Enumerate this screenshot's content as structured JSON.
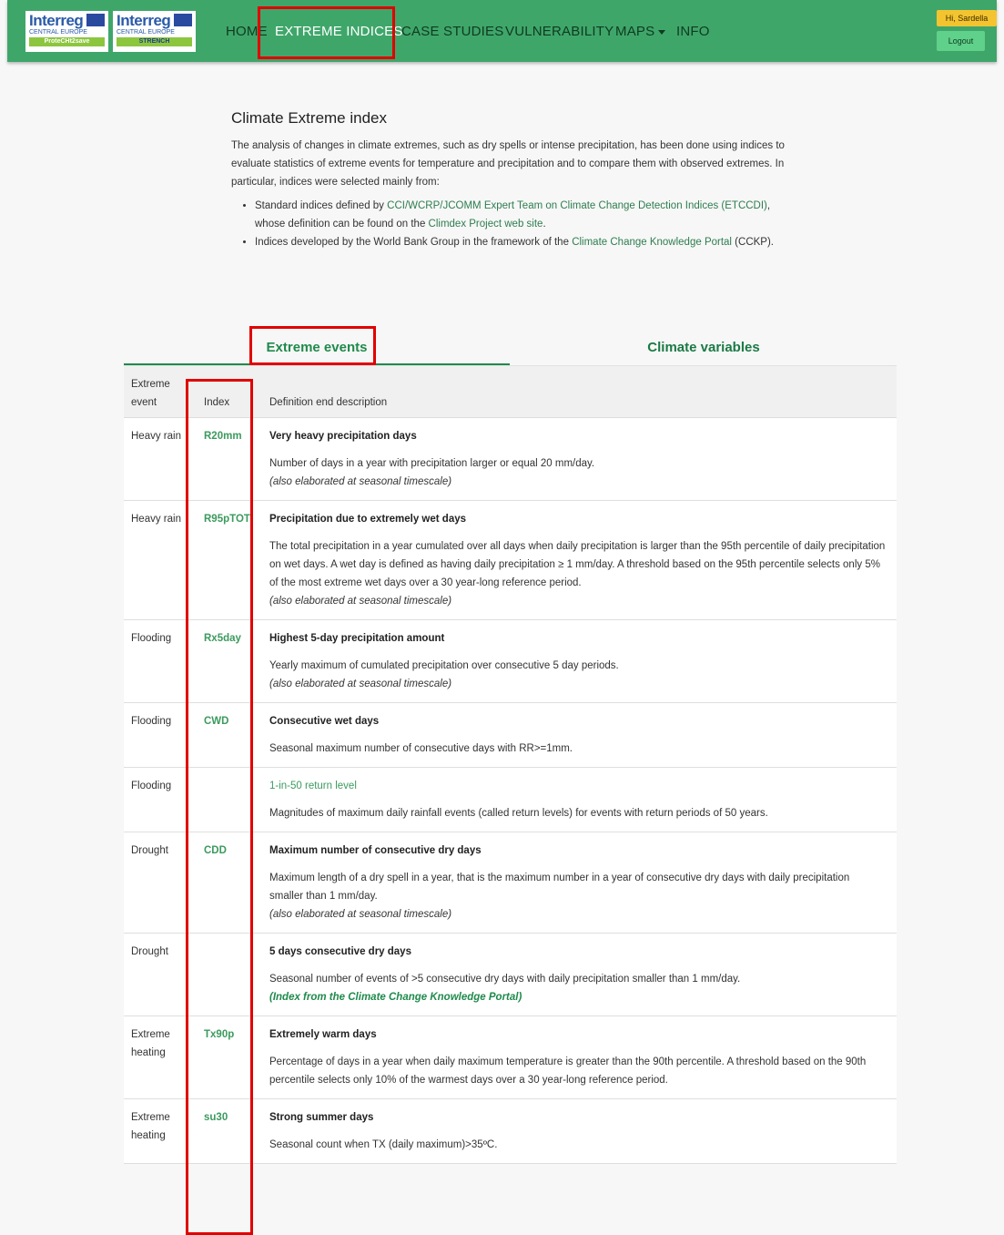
{
  "header": {
    "logos": [
      {
        "brand": "Interreg",
        "program": "CENTRAL EUROPE",
        "project": "ProteCHt2save"
      },
      {
        "brand": "Interreg",
        "program": "CENTRAL EUROPE",
        "project": "STRENCH"
      }
    ],
    "nav": [
      {
        "label": "HOME"
      },
      {
        "label": "EXTREME INDICES"
      },
      {
        "label": "CASE STUDIES"
      },
      {
        "label": "VULNERABILITY"
      },
      {
        "label": "MAPS"
      },
      {
        "label": "INFO"
      }
    ],
    "greeting": "Hi, Sardella",
    "logout": "Logout"
  },
  "intro": {
    "title": "Climate Extreme index",
    "paragraph": "The analysis of changes in climate extremes, such as dry spells or intense precipitation, has been done using indices to evaluate statistics of extreme events for temperature and precipitation and to compare them with observed extremes. In particular, indices were selected mainly from:",
    "bullet1": {
      "pre": "Standard indices defined by ",
      "link1": "CCI/WCRP/JCOMM Expert Team on Climate Change Detection Indices (ETCCDI)",
      "mid": ", whose definition can be found on the ",
      "link2": "Climdex Project web site",
      "post": "."
    },
    "bullet2": {
      "pre": "Indices developed by the World Bank Group in the framework of the ",
      "link": "Climate Change Knowledge Portal",
      "post": " (CCKP)."
    }
  },
  "tabs": [
    {
      "label": "Extreme events"
    },
    {
      "label": "Climate variables"
    }
  ],
  "table": {
    "headers": {
      "event": "Extreme event",
      "index": "Index",
      "definition": "Definition end description"
    },
    "rows": [
      {
        "event": "Heavy rain",
        "index": "R20mm",
        "title": "Very heavy precipitation days",
        "desc": "Number of days in a year with precipitation larger or equal 20 mm/day.",
        "note": "(also elaborated at seasonal timescale)"
      },
      {
        "event": "Heavy rain",
        "index": "R95pTOT",
        "title": "Precipitation due to extremely wet days",
        "desc": "The total precipitation in a year cumulated over all days when daily precipitation is larger than the 95th percentile of daily precipitation on wet days. A wet day is defined as having daily precipitation ≥ 1 mm/day. A threshold based on the 95th percentile selects only 5% of the most extreme wet days over a 30 year-long reference period.",
        "note": "(also elaborated at seasonal timescale)"
      },
      {
        "event": "Flooding",
        "index": "Rx5day",
        "title": "Highest 5-day precipitation amount",
        "desc": "Yearly maximum of cumulated precipitation over consecutive 5 day periods.",
        "note": "(also elaborated at seasonal timescale)"
      },
      {
        "event": "Flooding",
        "index": "CWD",
        "title": "Consecutive wet days",
        "desc": "Seasonal maximum number of consecutive days with RR>=1mm.",
        "note": ""
      },
      {
        "event": "Flooding",
        "index": "",
        "title": "1-in-50 return level",
        "desc": "Magnitudes of maximum daily rainfall events (called return levels) for events with return periods of 50 years.",
        "note": ""
      },
      {
        "event": "Drought",
        "index": "CDD",
        "title": "Maximum number of consecutive dry days",
        "desc": "Maximum length of a dry spell in a year, that is the maximum number in a year of consecutive dry days with daily precipitation smaller than 1 mm/day.",
        "note": "(also elaborated at seasonal timescale)"
      },
      {
        "event": "Drought",
        "index": "",
        "title": "5 days consecutive dry days",
        "desc": "Seasonal number of events of >5 consecutive dry days with daily precipitation smaller than 1 mm/day.",
        "note": "(Index from the Climate Change Knowledge Portal)"
      },
      {
        "event": "Extreme heating",
        "index": "Tx90p",
        "title": "Extremely warm days",
        "desc": "Percentage of days in a year when daily maximum temperature is greater than the 90th percentile. A threshold based on the 90th percentile selects only 10% of the warmest days over a 30 year-long reference period.",
        "note": ""
      },
      {
        "event": "Extreme heating",
        "index": "su30",
        "title": "Strong summer days",
        "desc": "Seasonal count when TX (daily maximum)>35ºC.",
        "note": ""
      }
    ]
  }
}
